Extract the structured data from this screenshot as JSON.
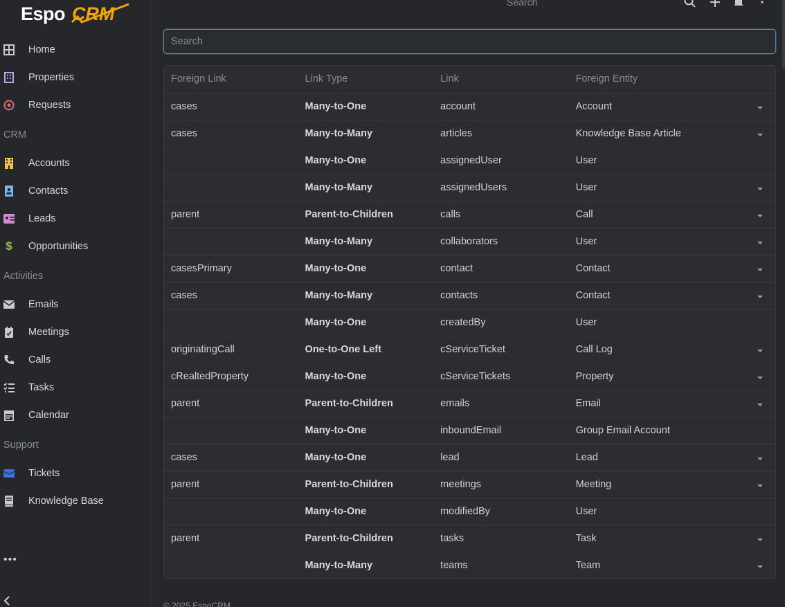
{
  "app": {
    "logo_left": "Espo",
    "logo_right": "CRM"
  },
  "sidebar": {
    "items": [
      {
        "label": "Home",
        "icon": "grid-icon",
        "color": "#c8cacc"
      },
      {
        "label": "Properties",
        "icon": "building-icon",
        "color": "#b3a7e6"
      },
      {
        "label": "Requests",
        "icon": "target-icon",
        "color": "#e06c75"
      },
      {
        "label": "Accounts",
        "icon": "office-icon",
        "color": "#f0c14b"
      },
      {
        "label": "Contacts",
        "icon": "contact-card-icon",
        "color": "#7eb6e6"
      },
      {
        "label": "Leads",
        "icon": "id-card-icon",
        "color": "#d48ad4"
      },
      {
        "label": "Opportunities",
        "icon": "dollar-icon",
        "color": "#8bc34a"
      },
      {
        "label": "Emails",
        "icon": "envelope-icon",
        "color": "#c8cacc"
      },
      {
        "label": "Meetings",
        "icon": "calendar-check-icon",
        "color": "#c8cacc"
      },
      {
        "label": "Calls",
        "icon": "phone-icon",
        "color": "#c8cacc"
      },
      {
        "label": "Tasks",
        "icon": "tasks-icon",
        "color": "#c8cacc"
      },
      {
        "label": "Calendar",
        "icon": "calendar-icon",
        "color": "#c8cacc"
      },
      {
        "label": "Tickets",
        "icon": "ticket-icon",
        "color": "#3f6fd8"
      },
      {
        "label": "Knowledge Base",
        "icon": "book-icon",
        "color": "#c8cacc"
      }
    ],
    "sections": {
      "crm": "CRM",
      "activities": "Activities",
      "support": "Support"
    },
    "more": "•••"
  },
  "topbar": {
    "search_placeholder": "Search"
  },
  "search": {
    "placeholder": "Search",
    "value": ""
  },
  "table": {
    "headers": [
      "Foreign Link",
      "Link Type",
      "Link",
      "Foreign Entity"
    ],
    "rows": [
      {
        "foreign_link": "cases",
        "link_type": "Many-to-One",
        "link": "account",
        "foreign_entity": "Account",
        "caret": true
      },
      {
        "foreign_link": "cases",
        "link_type": "Many-to-Many",
        "link": "articles",
        "foreign_entity": "Knowledge Base Article",
        "caret": true
      },
      {
        "foreign_link": "",
        "link_type": "Many-to-One",
        "link": "assignedUser",
        "foreign_entity": "User",
        "caret": false
      },
      {
        "foreign_link": "",
        "link_type": "Many-to-Many",
        "link": "assignedUsers",
        "foreign_entity": "User",
        "caret": true
      },
      {
        "foreign_link": "parent",
        "link_type": "Parent-to-Children",
        "link": "calls",
        "foreign_entity": "Call",
        "caret": true
      },
      {
        "foreign_link": "",
        "link_type": "Many-to-Many",
        "link": "collaborators",
        "foreign_entity": "User",
        "caret": true
      },
      {
        "foreign_link": "casesPrimary",
        "link_type": "Many-to-One",
        "link": "contact",
        "foreign_entity": "Contact",
        "caret": true
      },
      {
        "foreign_link": "cases",
        "link_type": "Many-to-Many",
        "link": "contacts",
        "foreign_entity": "Contact",
        "caret": true
      },
      {
        "foreign_link": "",
        "link_type": "Many-to-One",
        "link": "createdBy",
        "foreign_entity": "User",
        "caret": false
      },
      {
        "foreign_link": "originatingCall",
        "link_type": "One-to-One Left",
        "link": "cServiceTicket",
        "foreign_entity": "Call Log",
        "caret": true
      },
      {
        "foreign_link": "cRealtedProperty",
        "link_type": "Many-to-One",
        "link": "cServiceTickets",
        "foreign_entity": "Property",
        "caret": true
      },
      {
        "foreign_link": "parent",
        "link_type": "Parent-to-Children",
        "link": "emails",
        "foreign_entity": "Email",
        "caret": true
      },
      {
        "foreign_link": "",
        "link_type": "Many-to-One",
        "link": "inboundEmail",
        "foreign_entity": "Group Email Account",
        "caret": false
      },
      {
        "foreign_link": "cases",
        "link_type": "Many-to-One",
        "link": "lead",
        "foreign_entity": "Lead",
        "caret": true
      },
      {
        "foreign_link": "parent",
        "link_type": "Parent-to-Children",
        "link": "meetings",
        "foreign_entity": "Meeting",
        "caret": true
      },
      {
        "foreign_link": "",
        "link_type": "Many-to-One",
        "link": "modifiedBy",
        "foreign_entity": "User",
        "caret": false
      },
      {
        "foreign_link": "parent",
        "link_type": "Parent-to-Children",
        "link": "tasks",
        "foreign_entity": "Task",
        "caret": true
      },
      {
        "foreign_link": "",
        "link_type": "Many-to-Many",
        "link": "teams",
        "foreign_entity": "Team",
        "caret": true
      }
    ]
  },
  "footer": {
    "text": "© 2025 EspoCRM"
  }
}
